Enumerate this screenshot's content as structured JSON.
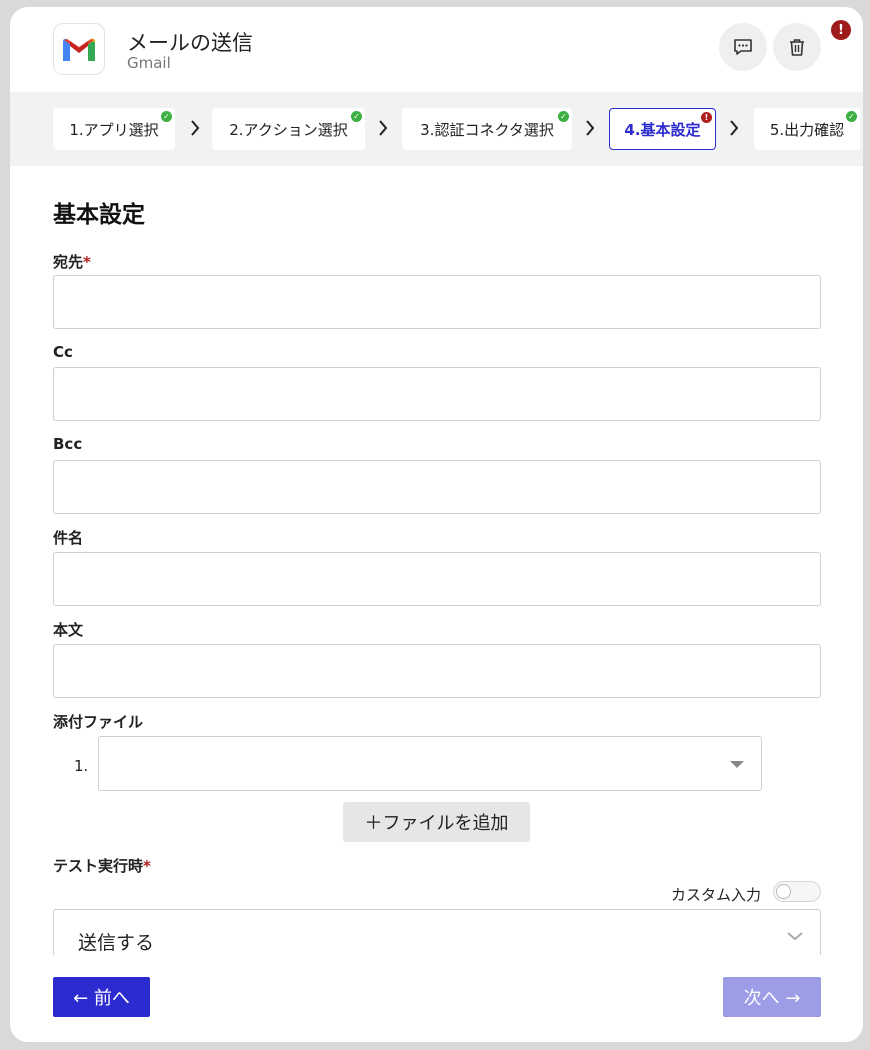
{
  "header": {
    "title": "メールの送信",
    "subtitle": "Gmail",
    "alert_badge": "!",
    "logo_icon": "gmail-logo-icon",
    "comment_icon": "comment-icon",
    "delete_icon": "trash-icon"
  },
  "stepper": {
    "steps": [
      {
        "label": "1.アプリ選択",
        "status": "complete"
      },
      {
        "label": "2.アクション選択",
        "status": "complete"
      },
      {
        "label": "3.認証コネクタ選択",
        "status": "complete"
      },
      {
        "label": "4.基本設定",
        "status": "error",
        "active": true
      },
      {
        "label": "5.出力確認",
        "status": "complete"
      }
    ],
    "status_marks": {
      "complete": "✓",
      "error": "!"
    }
  },
  "form": {
    "section_title": "基本設定",
    "required_mark": "*",
    "fields": [
      {
        "label": "宛先",
        "required": true,
        "value": ""
      },
      {
        "label": "Cc",
        "required": false,
        "value": ""
      },
      {
        "label": "Bcc",
        "required": false,
        "value": ""
      },
      {
        "label": "件名",
        "required": false,
        "value": ""
      },
      {
        "label": "本文",
        "required": false,
        "value": ""
      }
    ],
    "attachments": {
      "label": "添付ファイル",
      "items": [
        {
          "index": "1.",
          "value": ""
        }
      ],
      "add_button": "＋ファイルを追加"
    },
    "test_run": {
      "label": "テスト実行時",
      "required": true,
      "custom_input_label": "カスタム入力",
      "custom_input_on": false,
      "selected": "送信する"
    }
  },
  "footer": {
    "prev_label": "← 前へ",
    "next_label": "次へ →"
  },
  "colors": {
    "primary": "#2b2bd0",
    "primary_disabled": "#9d9ce6",
    "error": "#b01e1e",
    "success": "#3cb043"
  }
}
